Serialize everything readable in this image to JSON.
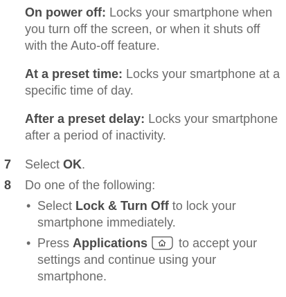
{
  "paragraphs": [
    {
      "term": "On power off:",
      "desc": " Locks your smartphone when you turn off the screen, or when it shuts off with the Auto-off feature."
    },
    {
      "term": "At a preset time:",
      "desc": " Locks your smartphone at a specific time of day."
    },
    {
      "term": "After a preset delay:",
      "desc": " Locks your smartphone after a period of inactivity."
    }
  ],
  "steps": [
    {
      "num": "7",
      "pre": "Select ",
      "bold": "OK",
      "post": "."
    },
    {
      "num": "8",
      "text": "Do one of the following:"
    }
  ],
  "bullets": [
    {
      "pre": "Select ",
      "bold": "Lock & Turn Off",
      "post": " to lock your smartphone immediately."
    },
    {
      "pre": "Press ",
      "bold": "Applications",
      "post": " to accept your settings and continue using your smartphone."
    }
  ],
  "icons": {
    "applications_key": "home-key-icon"
  }
}
